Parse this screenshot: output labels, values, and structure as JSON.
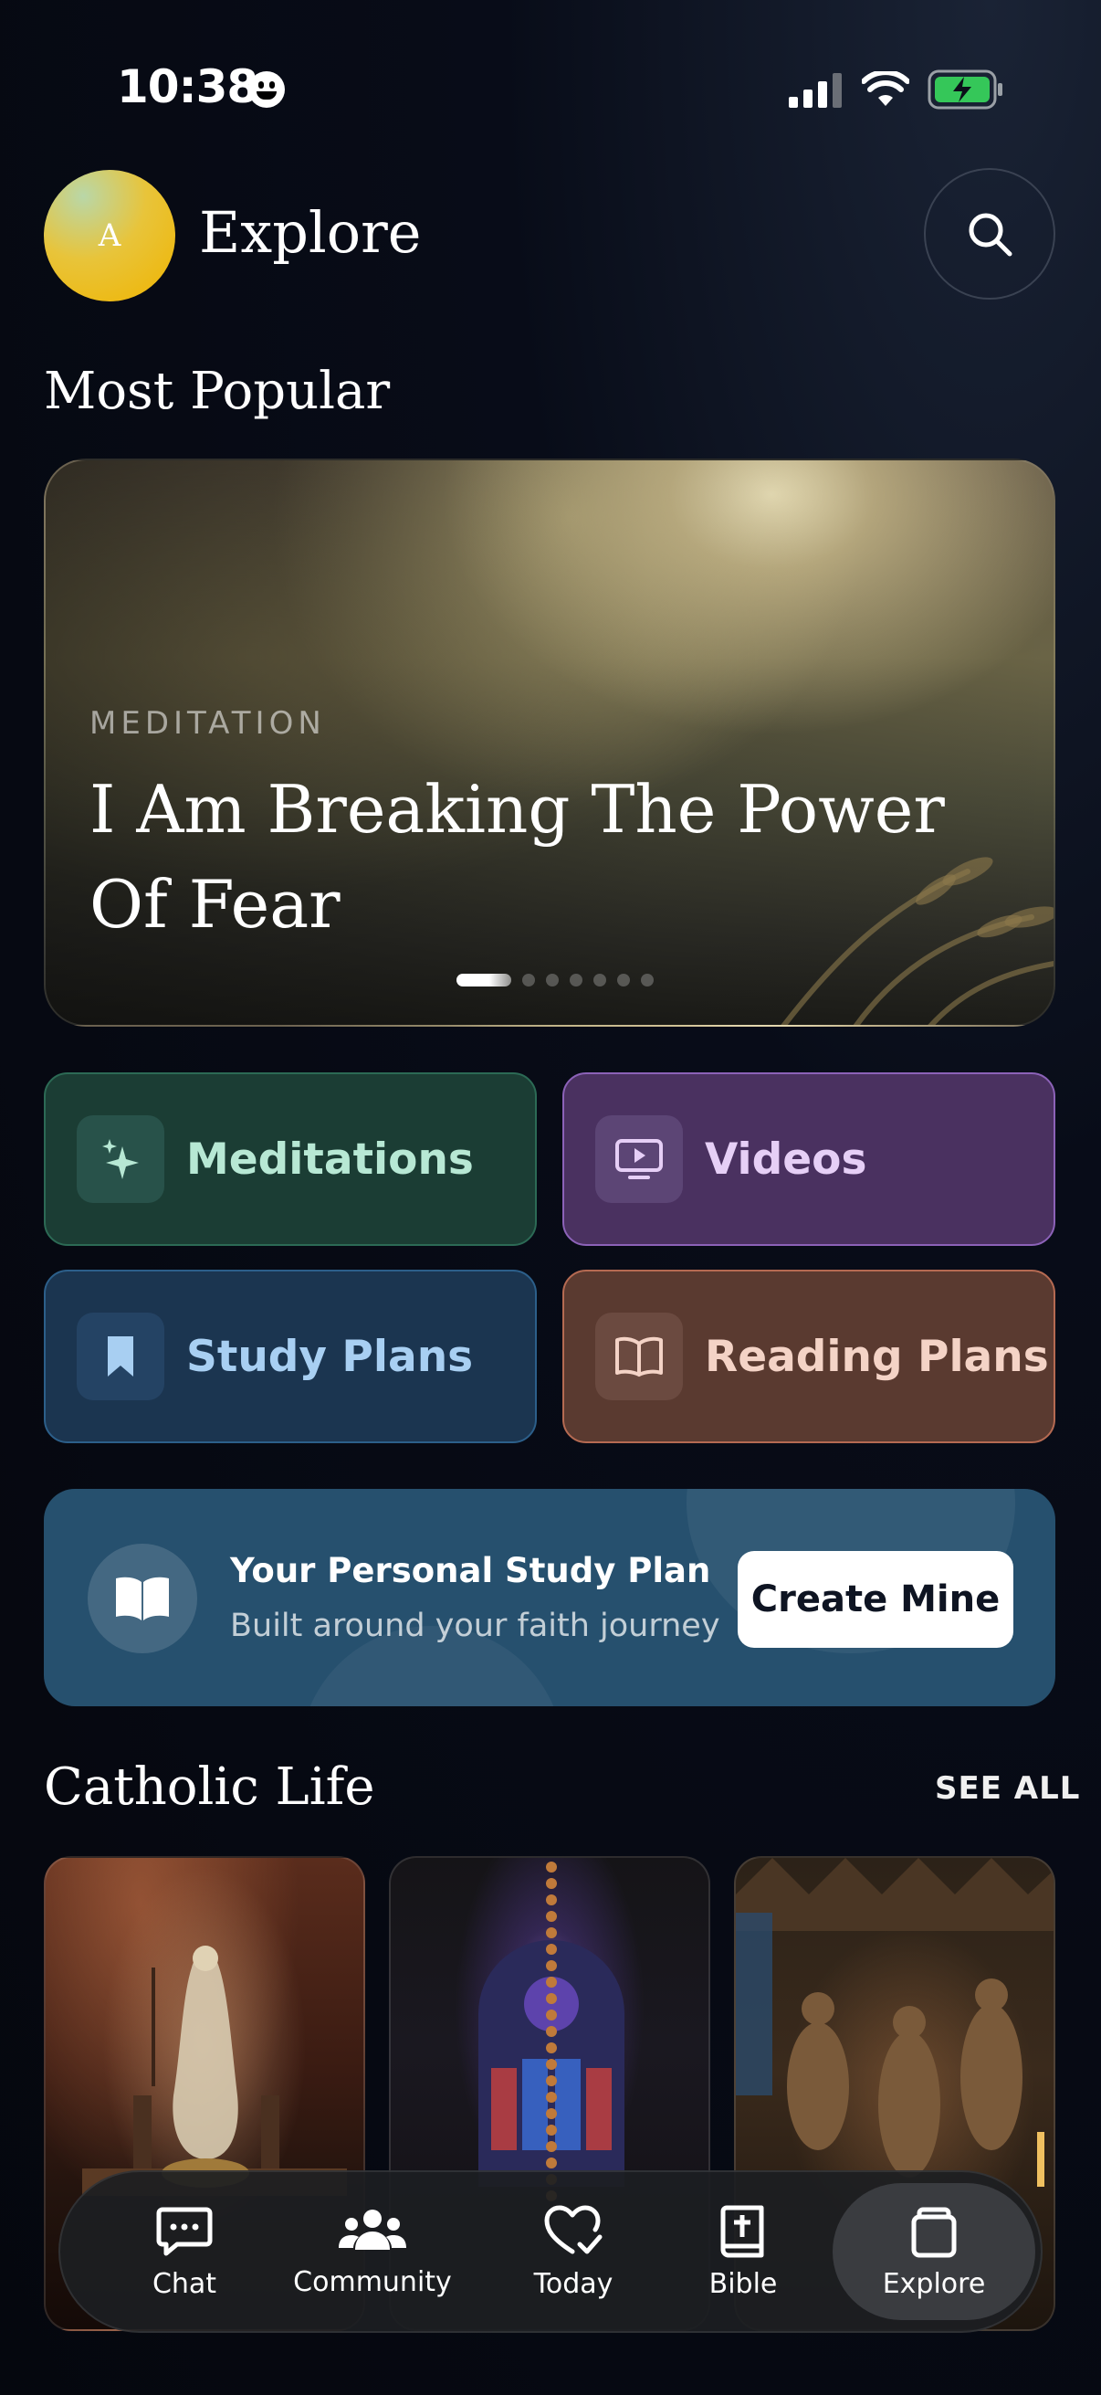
{
  "status_bar": {
    "time": "10:38"
  },
  "header": {
    "avatar_initial": "A",
    "title": "Explore"
  },
  "most_popular": {
    "title": "Most Popular",
    "hero": {
      "category": "MEDITATION",
      "title": "I Am Breaking The Power Of Fear",
      "page_count": 7,
      "active_page": 1
    }
  },
  "categories": [
    {
      "label": "Meditations",
      "icon": "sparkle-icon"
    },
    {
      "label": "Videos",
      "icon": "video-icon"
    },
    {
      "label": "Study Plans",
      "icon": "bookmark-icon"
    },
    {
      "label": "Reading Plans",
      "icon": "open-book-icon"
    }
  ],
  "study_plan_banner": {
    "title": "Your Personal Study Plan",
    "subtitle": "Built around your faith journey",
    "button_label": "Create Mine"
  },
  "catholic_life": {
    "title": "Catholic Life",
    "see_all_label": "SEE ALL"
  },
  "tab_bar": {
    "items": [
      {
        "label": "Chat",
        "icon": "chat-icon"
      },
      {
        "label": "Community",
        "icon": "community-icon"
      },
      {
        "label": "Today",
        "icon": "heart-check-icon"
      },
      {
        "label": "Bible",
        "icon": "bible-icon"
      },
      {
        "label": "Explore",
        "icon": "explore-icon"
      }
    ],
    "active": "Explore"
  },
  "colors": {
    "meditations": "#1b3d34",
    "videos": "#4a3160",
    "study_plans": "#1b3550",
    "reading_plans": "#5a3a30",
    "banner": "#26506e",
    "battery": "#35c759"
  }
}
